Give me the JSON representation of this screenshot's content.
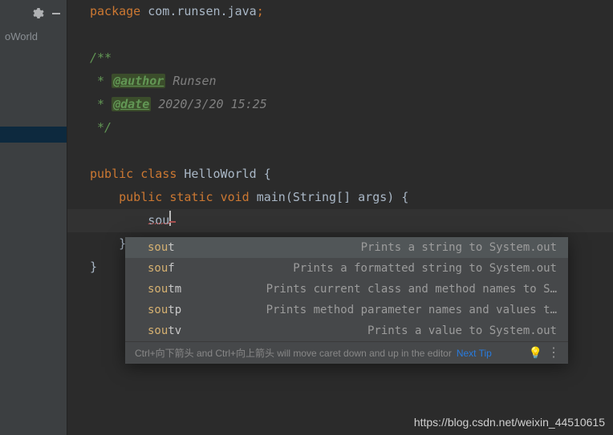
{
  "sidebar": {
    "file_label": "oWorld"
  },
  "code": {
    "pkg_kw": "package",
    "pkg_name": "com.runsen.java",
    "doc_open": "/**",
    "doc_star": " * ",
    "author_tag": "@author",
    "author_val": " Runsen",
    "date_tag": "@date",
    "date_val": " 2020/3/20 15:25",
    "doc_close": " */",
    "public": "public ",
    "class": "class ",
    "class_name": "HelloWorld ",
    "brace_open": "{",
    "static": "static ",
    "void": "void ",
    "main": "main",
    "args": "(String[] args) ",
    "typed": "sou",
    "brace_close": "}"
  },
  "completion": {
    "items": [
      {
        "prefix": "sou",
        "tail": "t",
        "desc": "Prints a string to System.out"
      },
      {
        "prefix": "sou",
        "tail": "f",
        "desc": "Prints a formatted string to System.out"
      },
      {
        "prefix": "sou",
        "tail": "tm",
        "desc": "Prints current class and method names to S…"
      },
      {
        "prefix": "sou",
        "tail": "tp",
        "desc": "Prints method parameter names and values t…"
      },
      {
        "prefix": "sou",
        "tail": "tv",
        "desc": "Prints a value to System.out"
      }
    ],
    "footer_hint": "Ctrl+向下箭头 and Ctrl+向上箭头 will move caret down and up in the editor",
    "next_tip": "Next Tip"
  },
  "watermark": "https://blog.csdn.net/weixin_44510615"
}
